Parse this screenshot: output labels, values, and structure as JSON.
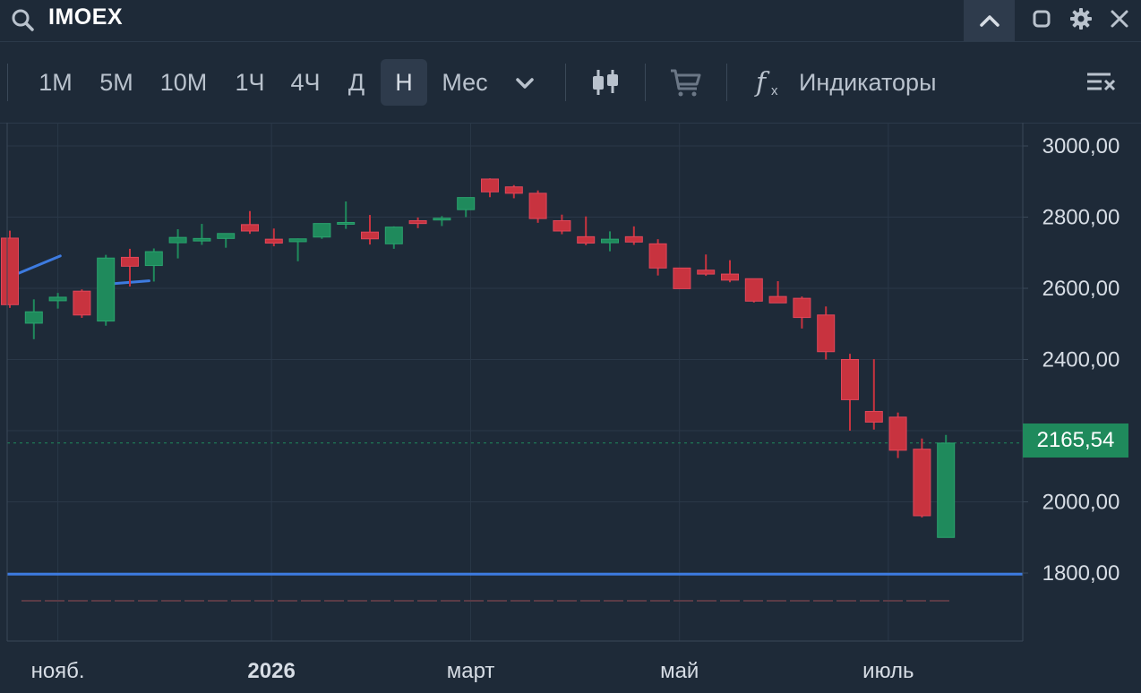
{
  "header": {
    "ticker": "IMOEX"
  },
  "toolbar": {
    "timeframes": [
      "1М",
      "5М",
      "10М",
      "1Ч",
      "4Ч",
      "Д",
      "Н",
      "Мес"
    ],
    "active_timeframe": "Н",
    "indicators_label": "Индикаторы"
  },
  "colors": {
    "background": "#1e2a38",
    "up": "#1f8a5c",
    "down": "#c8333f",
    "level_line": "#3d7be0",
    "current_price": "#1f8a5c"
  },
  "chart_data": {
    "type": "candlestick",
    "symbol": "IMOEX",
    "interval": "Н",
    "y_ticks": [
      "3000,00",
      "2800,00",
      "2600,00",
      "2400,00",
      "2000,00",
      "1800,00"
    ],
    "x_labels": [
      "нояб.",
      "2026",
      "март",
      "май",
      "июль"
    ],
    "ylim": [
      1690,
      3040
    ],
    "current_price": 2165.54,
    "current_price_label": "2165,54",
    "horizontal_level": 1797,
    "trend_segments": [
      [
        [
          0.0,
          2632
        ],
        [
          2.1,
          2691
        ]
      ],
      [
        [
          4.3,
          2613
        ],
        [
          5.8,
          2621
        ]
      ]
    ],
    "candles": [
      {
        "o": 2741,
        "h": 2762,
        "l": 2545,
        "c": 2554
      },
      {
        "o": 2502,
        "h": 2569,
        "l": 2457,
        "c": 2534
      },
      {
        "o": 2565,
        "h": 2587,
        "l": 2543,
        "c": 2575
      },
      {
        "o": 2592,
        "h": 2597,
        "l": 2517,
        "c": 2525
      },
      {
        "o": 2508,
        "h": 2694,
        "l": 2495,
        "c": 2685
      },
      {
        "o": 2687,
        "h": 2711,
        "l": 2605,
        "c": 2662
      },
      {
        "o": 2664,
        "h": 2712,
        "l": 2619,
        "c": 2703
      },
      {
        "o": 2728,
        "h": 2766,
        "l": 2684,
        "c": 2743
      },
      {
        "o": 2733,
        "h": 2781,
        "l": 2722,
        "c": 2740
      },
      {
        "o": 2740,
        "h": 2753,
        "l": 2714,
        "c": 2754
      },
      {
        "o": 2779,
        "h": 2817,
        "l": 2753,
        "c": 2761
      },
      {
        "o": 2738,
        "h": 2768,
        "l": 2718,
        "c": 2727
      },
      {
        "o": 2731,
        "h": 2740,
        "l": 2676,
        "c": 2739
      },
      {
        "o": 2744,
        "h": 2782,
        "l": 2739,
        "c": 2782
      },
      {
        "o": 2784,
        "h": 2844,
        "l": 2767,
        "c": 2785
      },
      {
        "o": 2758,
        "h": 2806,
        "l": 2723,
        "c": 2739
      },
      {
        "o": 2725,
        "h": 2774,
        "l": 2711,
        "c": 2772
      },
      {
        "o": 2790,
        "h": 2799,
        "l": 2769,
        "c": 2782
      },
      {
        "o": 2792,
        "h": 2803,
        "l": 2775,
        "c": 2797
      },
      {
        "o": 2821,
        "h": 2855,
        "l": 2800,
        "c": 2855
      },
      {
        "o": 2907,
        "h": 2909,
        "l": 2856,
        "c": 2871
      },
      {
        "o": 2885,
        "h": 2890,
        "l": 2853,
        "c": 2867
      },
      {
        "o": 2867,
        "h": 2875,
        "l": 2784,
        "c": 2796
      },
      {
        "o": 2790,
        "h": 2807,
        "l": 2752,
        "c": 2761
      },
      {
        "o": 2745,
        "h": 2802,
        "l": 2721,
        "c": 2727
      },
      {
        "o": 2728,
        "h": 2760,
        "l": 2704,
        "c": 2738
      },
      {
        "o": 2745,
        "h": 2774,
        "l": 2722,
        "c": 2730
      },
      {
        "o": 2725,
        "h": 2738,
        "l": 2636,
        "c": 2657
      },
      {
        "o": 2657,
        "h": 2657,
        "l": 2599,
        "c": 2599
      },
      {
        "o": 2651,
        "h": 2695,
        "l": 2635,
        "c": 2640
      },
      {
        "o": 2640,
        "h": 2679,
        "l": 2617,
        "c": 2623
      },
      {
        "o": 2627,
        "h": 2627,
        "l": 2560,
        "c": 2564
      },
      {
        "o": 2577,
        "h": 2620,
        "l": 2561,
        "c": 2559
      },
      {
        "o": 2572,
        "h": 2577,
        "l": 2487,
        "c": 2518
      },
      {
        "o": 2525,
        "h": 2549,
        "l": 2400,
        "c": 2422
      },
      {
        "o": 2400,
        "h": 2416,
        "l": 2200,
        "c": 2287
      },
      {
        "o": 2254,
        "h": 2401,
        "l": 2203,
        "c": 2224
      },
      {
        "o": 2238,
        "h": 2251,
        "l": 2123,
        "c": 2145
      },
      {
        "o": 2148,
        "h": 2178,
        "l": 1956,
        "c": 1961
      },
      {
        "o": 1900,
        "h": 2188,
        "l": 1900,
        "c": 2165
      }
    ]
  }
}
